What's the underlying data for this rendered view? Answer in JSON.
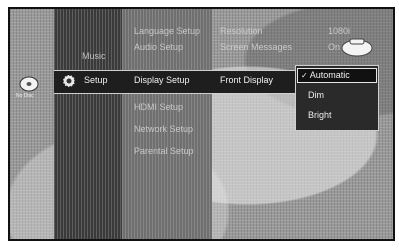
{
  "sidebar": {
    "nodisc_label": "No Disc",
    "items": [
      {
        "label": "Music"
      },
      {
        "label": "Setup"
      }
    ]
  },
  "submenu": {
    "items": [
      {
        "label": "Language Setup"
      },
      {
        "label": "Audio Setup"
      },
      {
        "label": "Display Setup"
      },
      {
        "label": "HDMI Setup"
      },
      {
        "label": "Network Setup"
      },
      {
        "label": "Parental Setup"
      }
    ]
  },
  "settings": {
    "rows": [
      {
        "label": "Resolution",
        "value": "1080i"
      },
      {
        "label": "Screen Messages",
        "value": "On"
      },
      {
        "label": "Front Display"
      }
    ]
  },
  "dropdown": {
    "options": [
      {
        "label": "Automatic",
        "checked": true
      },
      {
        "label": "Dim"
      },
      {
        "label": "Bright"
      }
    ]
  }
}
